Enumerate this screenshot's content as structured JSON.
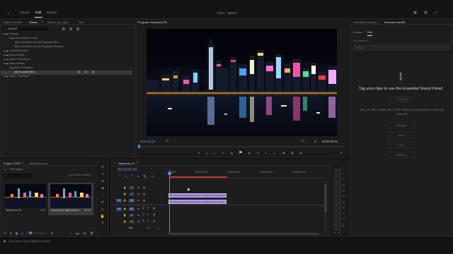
{
  "topbar": {
    "tabs": [
      "Import",
      "Edit",
      "Export"
    ],
    "active_tab": "Edit",
    "project_title": "TEST - Edited"
  },
  "effects_panel": {
    "tabs": [
      "Effect Controls",
      "Effects",
      "Sound: (no clips)",
      "Text"
    ],
    "active_tab": "Effects",
    "search_value": "GAUSS",
    "tree": [
      {
        "label": "Presets",
        "indent": 0,
        "type": "folder"
      },
      {
        "label": "Convolution Kernel",
        "indent": 1,
        "type": "folder"
      },
      {
        "label": "Convolution Kernel Gaussian Blur",
        "indent": 2,
        "type": "fx"
      },
      {
        "label": "Convolution Kernel Gaussian Sharpen",
        "indent": 2,
        "type": "fx"
      },
      {
        "label": "Lumetri Presets",
        "indent": 0,
        "type": "folder"
      },
      {
        "label": "Audio Effects",
        "indent": 0,
        "type": "folder"
      },
      {
        "label": "Audio Transitions",
        "indent": 0,
        "type": "folder"
      },
      {
        "label": "Video Effects",
        "indent": 0,
        "type": "folder"
      },
      {
        "label": "Blur & Sharpen",
        "indent": 1,
        "type": "folder"
      },
      {
        "label": "Gaussian Blur",
        "indent": 2,
        "type": "fx",
        "selected": true
      },
      {
        "label": "Video Transitions",
        "indent": 0,
        "type": "folder"
      }
    ]
  },
  "program_monitor": {
    "title": "Program: Sequence 01",
    "timecode_current": "00:00:00:00",
    "zoom": "Fit",
    "quality": "1/2",
    "timecode_duration": "00:00:09:01"
  },
  "essential_sound": {
    "tabs": [
      "Essential Graphics",
      "Essential Sound"
    ],
    "active_tab": "Essential Sound",
    "subtabs": [
      "Browse",
      "Edit"
    ],
    "active_subtab": "Edit",
    "no_selection": "No Selection",
    "preset_placeholder": "Preset",
    "headline": "Tag your clips to use the Essential Sound Panel",
    "tag_button": "Dialogue",
    "hint": "You can also assign one of the following audio types to each clip yourself",
    "types": [
      "Dialogue",
      "Music",
      "SFX",
      "Ambience"
    ]
  },
  "project_panel": {
    "tabs": [
      "Project: TEST",
      "Media Browser"
    ],
    "active_tab": "Project: TEST",
    "filename": "TEST.prproj",
    "selection_info": "1 of 2 items selected",
    "items": [
      {
        "name": "Sequence 01",
        "duration": "9:01"
      },
      {
        "name": "hong kong night aerial v...",
        "duration": "09:01"
      }
    ]
  },
  "timeline": {
    "tab": "Sequence 01",
    "timecode": "00:00:00:00",
    "ruler_labels": [
      ":00:00",
      "00:00:04:23",
      "00:00:09:23",
      "00:00:14:23",
      "00:00:19:23"
    ],
    "tracks": [
      {
        "name": "V3",
        "kind": "video"
      },
      {
        "name": "V2",
        "kind": "video"
      },
      {
        "name": "V1",
        "kind": "video",
        "source": "V1"
      },
      {
        "name": "A1",
        "kind": "audio",
        "source": "A1"
      },
      {
        "name": "A2",
        "kind": "audio"
      },
      {
        "name": "A3",
        "kind": "audio"
      },
      {
        "name": "Mix",
        "kind": "mix",
        "value": "0.0"
      }
    ],
    "clips": [
      {
        "label": "hong kong night aerial video of Hong Kong city islands-4",
        "track": "V1"
      },
      {
        "label": "hong kong night aerial video of Hong Kong city islands-4",
        "track": "A1"
      }
    ],
    "meter_labels": [
      "0",
      "-6",
      "-12",
      "-18",
      "-24",
      "-30",
      "-36",
      "-42",
      "-48",
      "-54",
      "dB"
    ],
    "meter_bottom": [
      "S",
      "S"
    ]
  },
  "statusbar": {
    "text": "Drop ideas a clip to apply this default"
  },
  "colors": {
    "accent": "#4f8fe8",
    "clip": "#a88ee0",
    "playhead": "#4f8fe8",
    "inout_red": "#c83232"
  },
  "icons": [
    "home-icon",
    "search-icon",
    "new-bin-icon",
    "play-icon",
    "step-back-icon",
    "step-forward-icon",
    "camera-icon",
    "settings-icon",
    "sound-wave-icon",
    "razor-icon",
    "selection-icon",
    "hand-icon",
    "type-icon"
  ]
}
